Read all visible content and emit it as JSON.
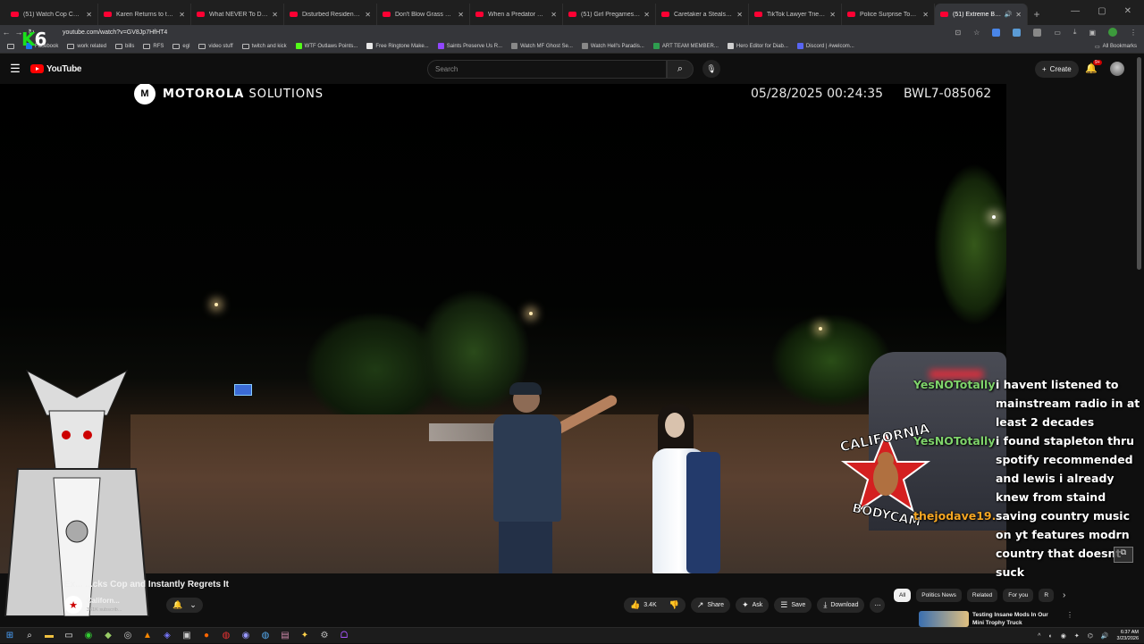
{
  "browser": {
    "tabs": [
      {
        "title": "(51) Watch Cop Cam - Yo",
        "active": false
      },
      {
        "title": "Karen Returns to the Gas",
        "active": false
      },
      {
        "title": "What NEVER To Do During",
        "active": false
      },
      {
        "title": "Disturbed Resident Attem",
        "active": false
      },
      {
        "title": "Don't Blow Grass On Her",
        "active": false
      },
      {
        "title": "When a Predator Gets Cau",
        "active": false
      },
      {
        "title": "(51) Girl Pregames Thanks",
        "active": false
      },
      {
        "title": "Caretaker a Steals Badge",
        "active": false
      },
      {
        "title": "TikTok Lawyer Tries to Bul",
        "active": false
      },
      {
        "title": "Police Surprise Toxic Coup",
        "active": false
      },
      {
        "title": "(51) Extreme Banshee",
        "active": true
      }
    ],
    "new_tab": "+",
    "window_controls": {
      "minimize": "—",
      "maximize": "▢",
      "close": "✕"
    },
    "url": "youtube.com/watch?v=GV8Jp7HfHT4",
    "bookmarks": [
      {
        "label": "",
        "type": "folder"
      },
      {
        "label": "Facebook",
        "type": "site",
        "color": "#1877f2"
      },
      {
        "label": "work related",
        "type": "folder"
      },
      {
        "label": "bills",
        "type": "folder"
      },
      {
        "label": "RFS",
        "type": "folder"
      },
      {
        "label": "egl",
        "type": "folder"
      },
      {
        "label": "video stuff",
        "type": "folder"
      },
      {
        "label": "twitch and kick",
        "type": "folder"
      },
      {
        "label": "WTF Outlaws Points...",
        "type": "site",
        "color": "#53fc18"
      },
      {
        "label": "Free Ringtone Make...",
        "type": "site",
        "color": "#e8e8e8"
      },
      {
        "label": "Saints Preserve Us R...",
        "type": "site",
        "color": "#9146ff"
      },
      {
        "label": "Watch MF Ghost Se...",
        "type": "site",
        "color": "#888888"
      },
      {
        "label": "Watch Hell's Paradis...",
        "type": "site",
        "color": "#888888"
      },
      {
        "label": "ART TEAM MEMBER...",
        "type": "site",
        "color": "#2e9e4f"
      },
      {
        "label": "Hero Editor for Diab...",
        "type": "site",
        "color": "#cfcfcf"
      },
      {
        "label": "Discord | #welcom...",
        "type": "site",
        "color": "#5865f2"
      }
    ],
    "all_bookmarks": "All Bookmarks"
  },
  "overlay_logo": {
    "k": "K",
    "num": "6"
  },
  "youtube": {
    "logo_text": "YouTube",
    "search_placeholder": "Search",
    "create_label": "Create",
    "notification_count": "9+"
  },
  "video": {
    "brand_bold": "MOTOROLA",
    "brand_light": " SOLUTIONS",
    "brand_emblem": "M",
    "timestamp": "05/28/2025 00:24:35",
    "camera_id": "BWL7-085062",
    "badge_top": "CALIFORNIA",
    "badge_bottom": "BODYCAM",
    "chat": [
      {
        "user": "YesNOTotally",
        "color": "#7fd36b",
        "text": "i havent listened to mainstream radio in at least 2 decades"
      },
      {
        "user": "YesNOTotally",
        "color": "#7fd36b",
        "text": "i found stapleton thru spotify recommended and lewis i already knew from staind"
      },
      {
        "user": "thejodave19...",
        "color": "#f5a623",
        "text": "saving country music on yt features modrn country that doesnt suck"
      }
    ]
  },
  "meta": {
    "title": "Ex... ...cks Cop and Instantly Regrets It",
    "channel_name": "Californ...",
    "channel_subs": "361K subscrib...",
    "like_count": "3.4K",
    "share": "Share",
    "ask": "Ask",
    "save": "Save",
    "download": "Download"
  },
  "sidebar": {
    "chips": [
      "All",
      "Politics News",
      "Related",
      "For you",
      "R"
    ],
    "selected_chip": "All",
    "rec_title": "Testing Insane Mods In Our Mini Trophy Truck"
  },
  "taskbar": {
    "time": "6:37 AM",
    "date": "3/23/2026"
  }
}
